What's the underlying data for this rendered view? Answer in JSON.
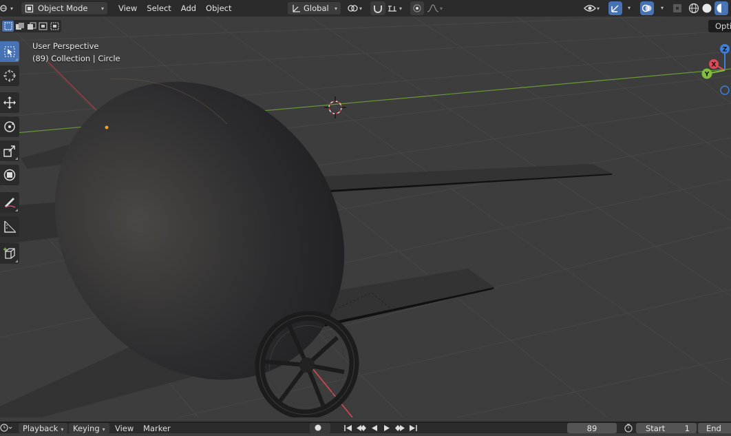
{
  "header": {
    "mode_label": "Object Mode",
    "menus": [
      "View",
      "Select",
      "Add",
      "Object"
    ],
    "orientation_label": "Global"
  },
  "viewport": {
    "view_name": "User Perspective",
    "collection_info": "(89) Collection | Circle",
    "options_label": "Opti",
    "gizmo": {
      "z": "Z",
      "x": "X",
      "y": "Y"
    }
  },
  "tools": [
    {
      "name": "select-box",
      "icon": "cursor-select-icon"
    },
    {
      "name": "cursor",
      "icon": "3d-cursor-icon"
    },
    {
      "name": "move",
      "icon": "move-icon"
    },
    {
      "name": "rotate",
      "icon": "rotate-icon"
    },
    {
      "name": "scale",
      "icon": "scale-icon"
    },
    {
      "name": "transform",
      "icon": "transform-icon"
    },
    {
      "name": "annotate",
      "icon": "annotate-icon"
    },
    {
      "name": "measure",
      "icon": "measure-icon"
    },
    {
      "name": "add-cube",
      "icon": "add-cube-icon"
    }
  ],
  "timeline": {
    "playback_label": "Playback",
    "keying_label": "Keying",
    "view_label": "View",
    "marker_label": "Marker",
    "current_frame": "89",
    "start_label": "Start",
    "start_value": "1",
    "end_label": "End"
  },
  "colors": {
    "accent": "#4772b3",
    "header_bg": "#2b2b2b",
    "viewport_bg": "#3d3d3d",
    "x_axis": "#e04856",
    "y_axis": "#7fbf3a",
    "z_axis": "#3d7fd9"
  }
}
